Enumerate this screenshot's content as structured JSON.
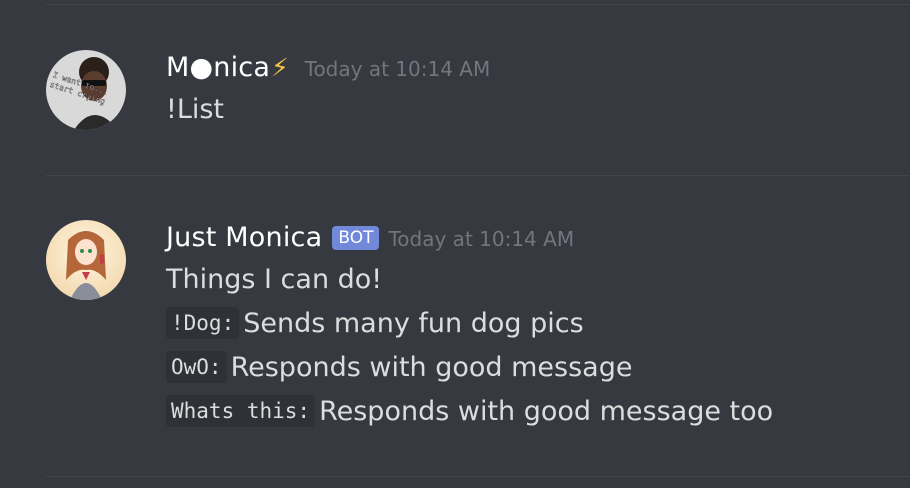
{
  "messages": [
    {
      "username": "M●nica",
      "bolt": "⚡",
      "timestamp": "Today at 10:14 AM",
      "content": "!List",
      "avatar_caption": "I want to... start crying"
    },
    {
      "username": "Just Monica",
      "bot_tag": "BOT",
      "timestamp": "Today at 10:14 AM",
      "intro": "Things I can do!",
      "commands": [
        {
          "code": "!Dog:",
          "text": "Sends many fun dog pics"
        },
        {
          "code": "OwO:",
          "text": "Responds with good message"
        },
        {
          "code": "Whats this:",
          "text": "Responds with good message too"
        }
      ]
    }
  ],
  "colors": {
    "background": "#36393f",
    "username": "#ffffff",
    "timestamp": "#72767d",
    "bot_tag": "#7289da",
    "code_bg": "#2f3136"
  }
}
